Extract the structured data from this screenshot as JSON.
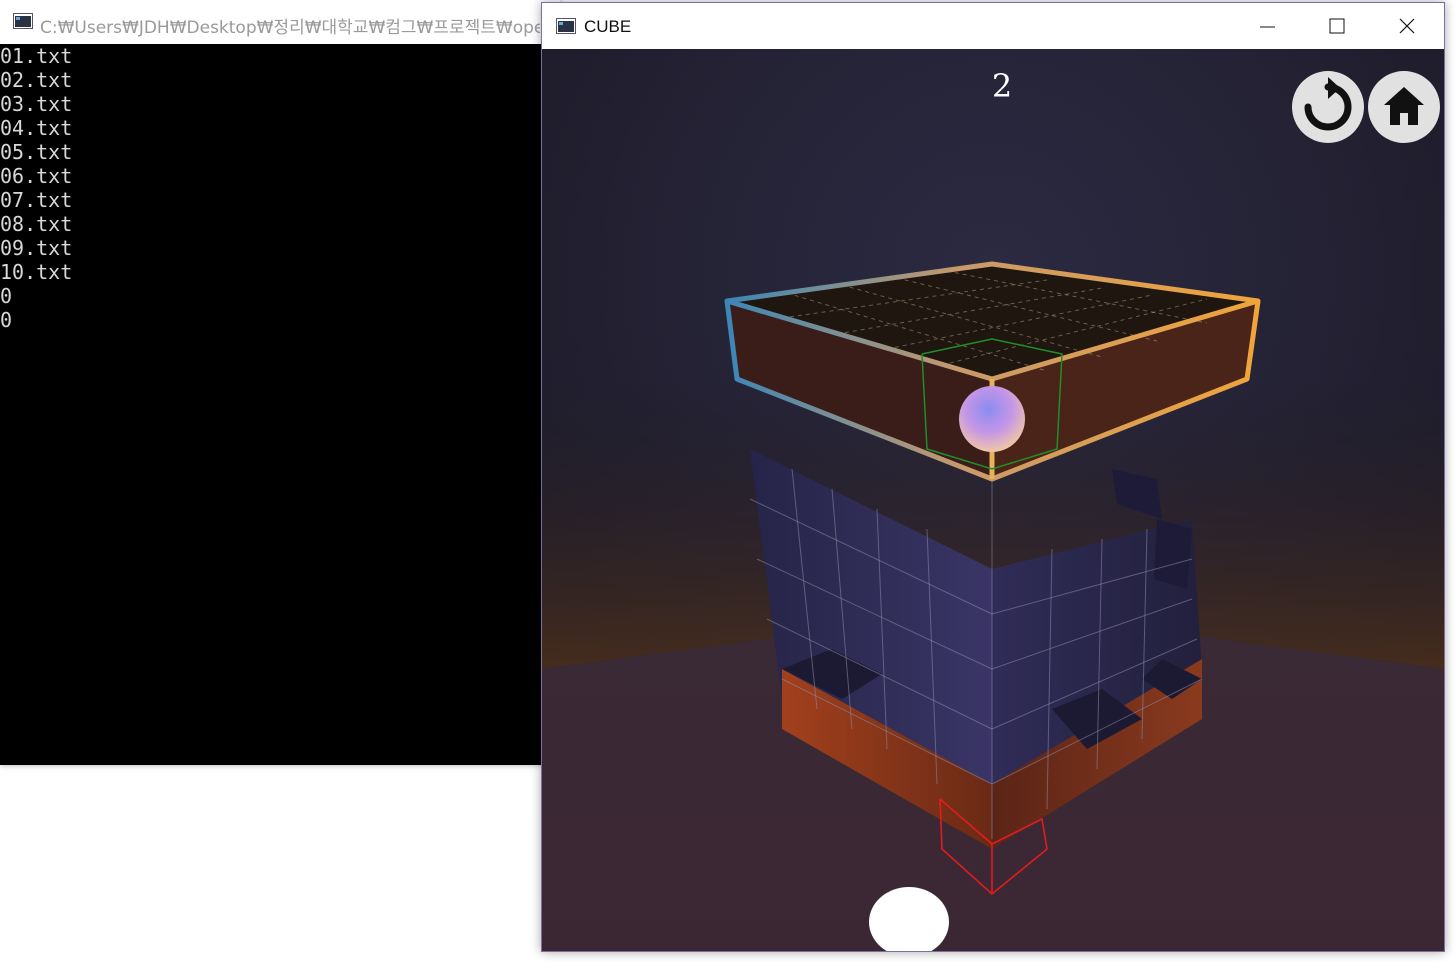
{
  "console": {
    "title": "C:₩Users₩JDH₩Desktop₩정리₩대학교₩컴그₩프로젝트₩ope",
    "lines": [
      "01.txt",
      "02.txt",
      "03.txt",
      "04.txt",
      "05.txt",
      "06.txt",
      "07.txt",
      "08.txt",
      "09.txt",
      "10.txt",
      "0",
      "0"
    ]
  },
  "game_window": {
    "title": "CUBE",
    "score": "2",
    "buttons": {
      "restart_icon": "restart-icon",
      "home_icon": "home-icon"
    }
  },
  "colors": {
    "console_bg": "#000000",
    "console_text": "#d8d8d8",
    "top_frame": "#e6b25a",
    "selection_red": "#e21c1c",
    "player_sphere": "#c89ae6"
  }
}
